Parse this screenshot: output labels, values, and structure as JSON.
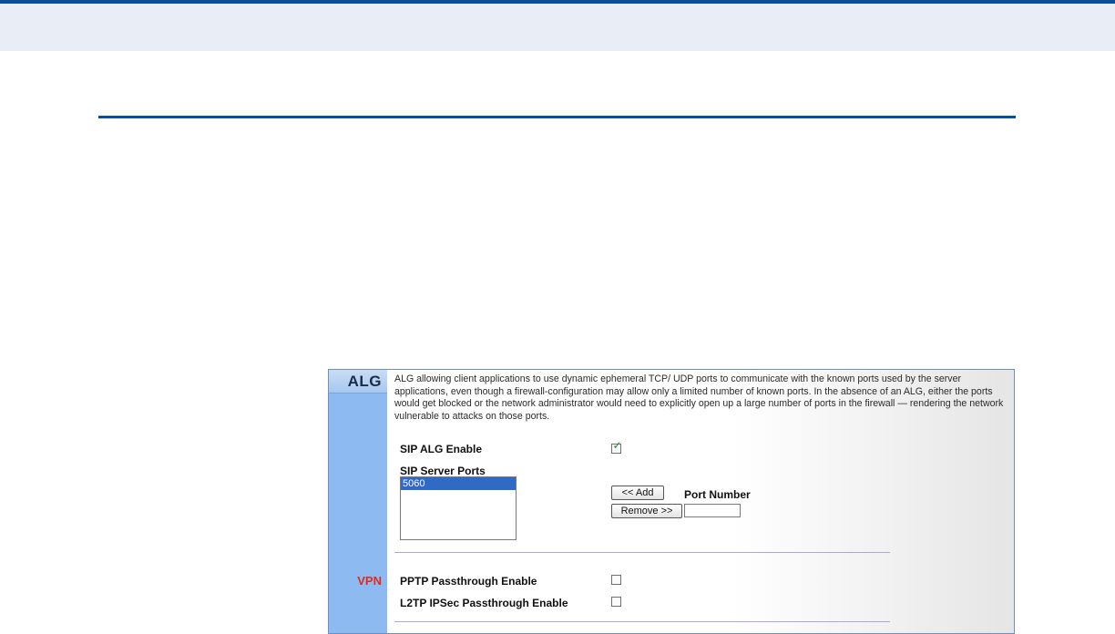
{
  "sections": {
    "alg": "ALG",
    "vpn": "VPN"
  },
  "alg": {
    "description": "ALG allowing client applications to use dynamic ephemeral TCP/ UDP ports to communicate with the known ports used by the server applications, even though a firewall-configuration may allow only a limited number of known ports. In the absence of an ALG, either the ports would get blocked or the network administrator would need to explicitly open up a large number of ports in the firewall — rendering the network vulnerable to attacks on those ports.",
    "sip_enable_label": "SIP ALG Enable",
    "sip_enable_checked": true,
    "sip_ports_label": "SIP Server Ports",
    "sip_ports": [
      "5060"
    ],
    "add_button": "<< Add",
    "remove_button": "Remove >>",
    "port_number_label": "Port Number",
    "port_number_value": ""
  },
  "vpn": {
    "pptp_label": "PPTP Passthrough Enable",
    "pptp_checked": false,
    "l2tp_label": "L2TP IPSec Passthrough Enable",
    "l2tp_checked": false
  },
  "colors": {
    "header_rule": "#0b4f9c",
    "sidebar": "#8dbbf1",
    "vpn_label": "#e12a1c",
    "selection": "#316ac5"
  },
  "icons": {
    "checkbox_checked": "check-mark-icon"
  }
}
